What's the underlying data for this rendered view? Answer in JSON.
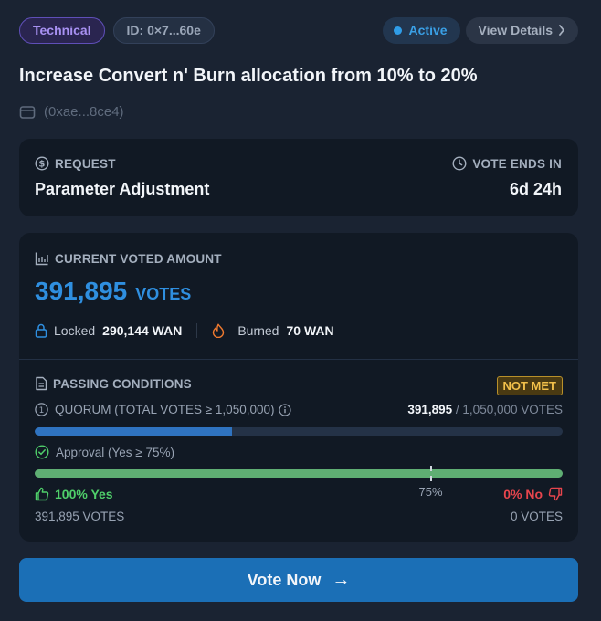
{
  "header": {
    "category": "Technical",
    "id_label": "ID: 0×7...60e",
    "status": "Active",
    "view_details": "View Details"
  },
  "proposal": {
    "title": "Increase Convert n' Burn allocation from 10% to 20%",
    "proposer": "(0xae...8ce4)"
  },
  "request": {
    "label": "REQUEST",
    "value": "Parameter Adjustment",
    "ends_label": "VOTE ENDS IN",
    "ends_value": "6d 24h"
  },
  "votes": {
    "label": "CURRENT VOTED AMOUNT",
    "amount": "391,895",
    "unit": "VOTES",
    "locked_label": "Locked",
    "locked_value": "290,144 WAN",
    "burned_label": "Burned",
    "burned_value": "70 WAN"
  },
  "conditions": {
    "label": "PASSING CONDITIONS",
    "status": "NOT MET",
    "quorum_label": "QUORUM (TOTAL VOTES ≥ 1,050,000)",
    "quorum_current": "391,895",
    "quorum_target": "/ 1,050,000 VOTES",
    "quorum_progress": 0.3732,
    "approval_label": "Approval (Yes ≥ 75%)",
    "approval_progress": 1.0,
    "threshold": 0.75,
    "threshold_label": "75%",
    "yes_label": "100% Yes",
    "no_label": "0% No",
    "yes_votes": "391,895 VOTES",
    "no_votes": "0 VOTES"
  },
  "action": {
    "vote_label": "Vote Now",
    "arrow": "→"
  },
  "colors": {
    "accent": "#2f8fe0",
    "yes": "#4fcf6a",
    "no": "#e8454d",
    "warning": "#f2c04a",
    "button": "#1b6fb6"
  }
}
